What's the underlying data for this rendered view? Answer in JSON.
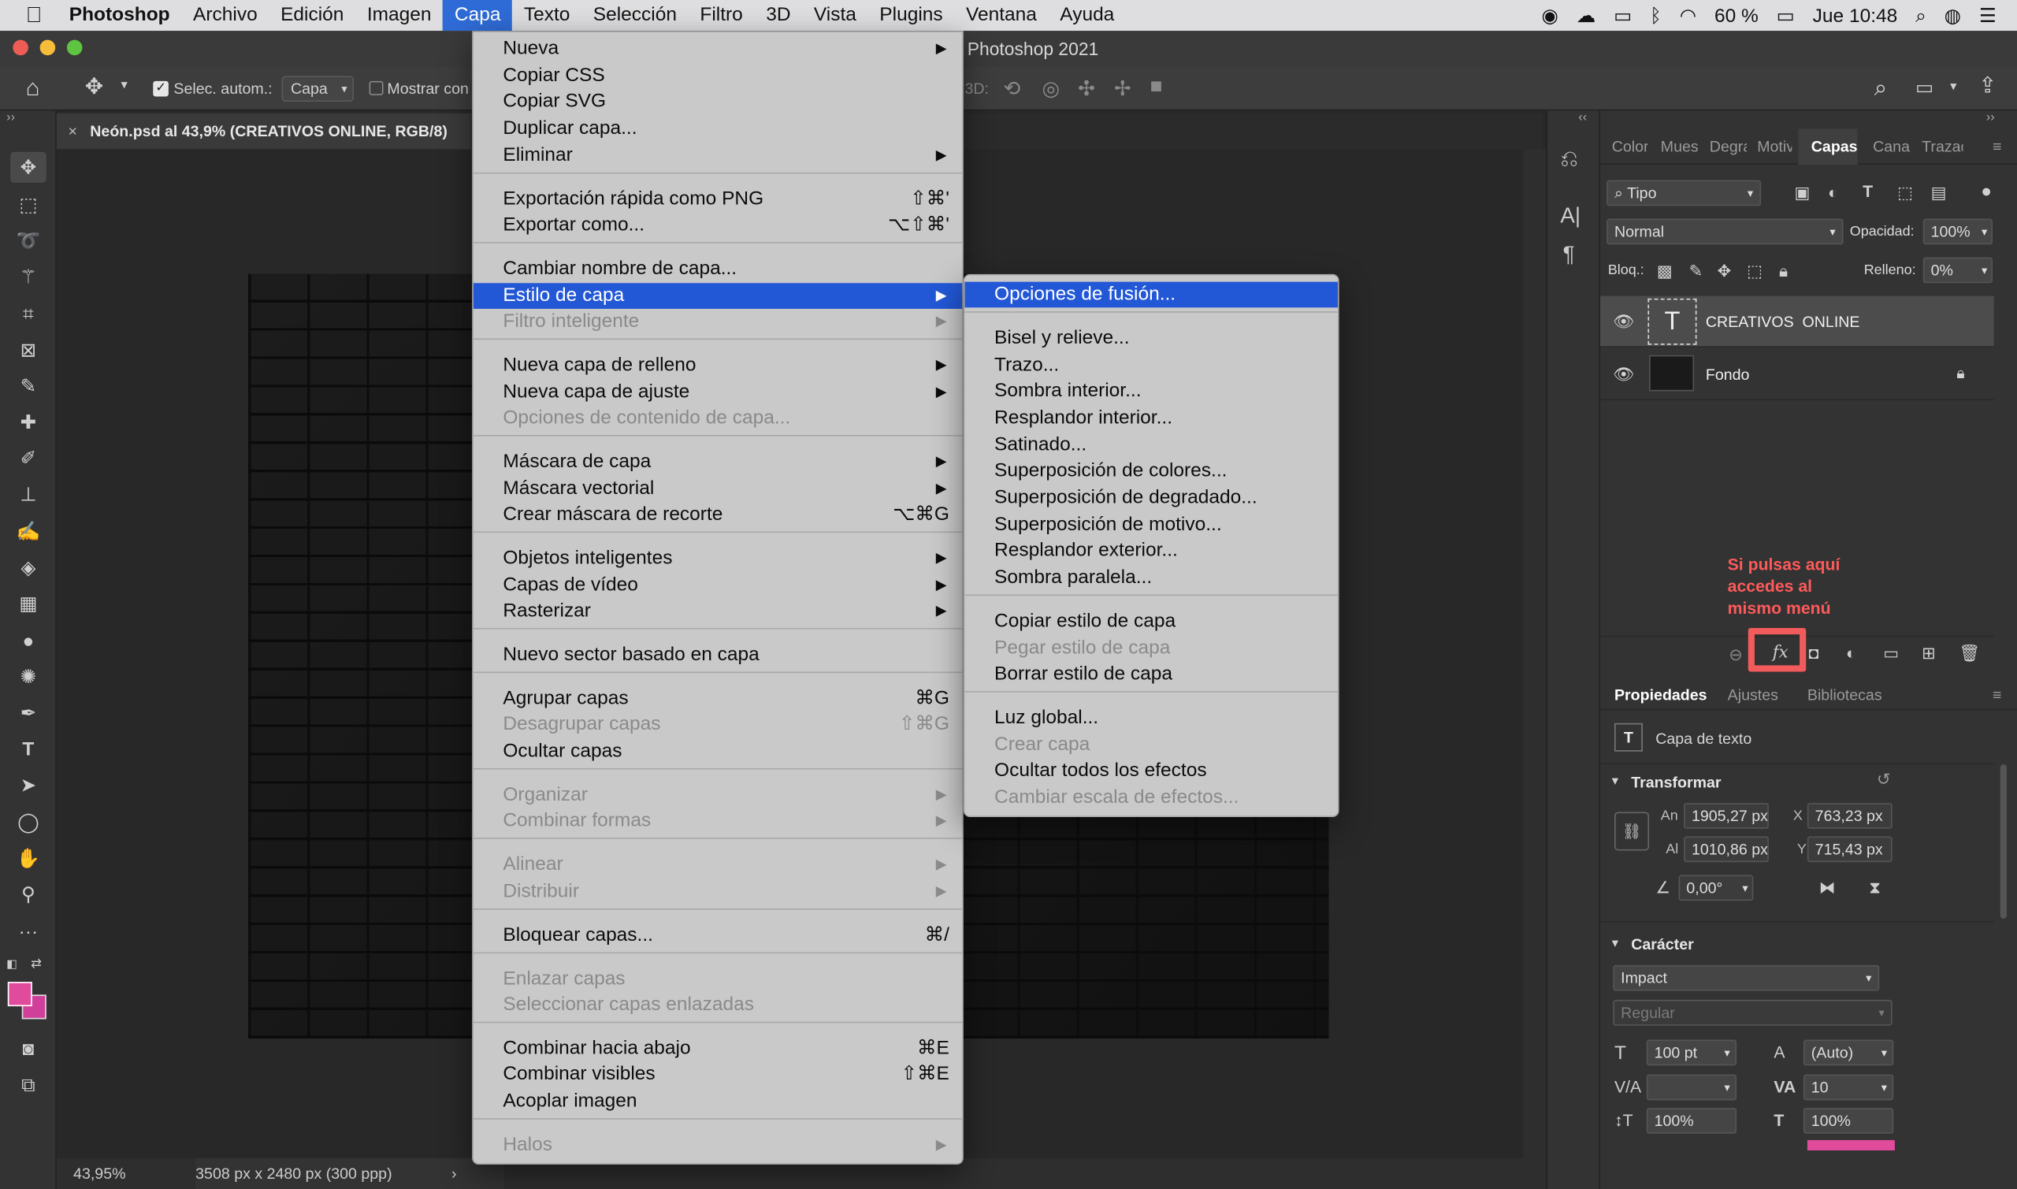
{
  "menubar": {
    "apple": "",
    "app": "Photoshop",
    "items": [
      "Archivo",
      "Edición",
      "Imagen",
      "Capa",
      "Texto",
      "Selección",
      "Filtro",
      "3D",
      "Vista",
      "Plugins",
      "Ventana",
      "Ayuda"
    ],
    "battery": "60 %",
    "clock": "Jue 10:48"
  },
  "window": {
    "title": "Photoshop 2021"
  },
  "options": {
    "autoselect_label": "Selec. autom.:",
    "autoselect_value": "Capa",
    "show_controls": "Mostrar con",
    "mode3d": "3D:"
  },
  "document": {
    "tab": "Neón.psd al 43,9% (CREATIVOS  ONLINE, RGB/8)",
    "zoom": "43,95%",
    "info": "3508 px x 2480 px (300 ppp)"
  },
  "capa_menu": {
    "items": [
      {
        "label": "Nueva",
        "submenu": true
      },
      {
        "label": "Copiar CSS"
      },
      {
        "label": "Copiar SVG"
      },
      {
        "label": "Duplicar capa..."
      },
      {
        "label": "Eliminar",
        "submenu": true
      },
      {
        "label": "Exportación rápida como PNG",
        "shortcut": "⇧⌘'"
      },
      {
        "label": "Exportar como...",
        "shortcut": "⌥⇧⌘'"
      },
      {
        "label": "Cambiar nombre de capa..."
      },
      {
        "label": "Estilo de capa",
        "submenu": true,
        "highlighted": true
      },
      {
        "label": "Filtro inteligente",
        "submenu": true,
        "disabled": true
      },
      {
        "label": "Nueva capa de relleno",
        "submenu": true
      },
      {
        "label": "Nueva capa de ajuste",
        "submenu": true
      },
      {
        "label": "Opciones de contenido de capa...",
        "disabled": true
      },
      {
        "label": "Máscara de capa",
        "submenu": true
      },
      {
        "label": "Máscara vectorial",
        "submenu": true
      },
      {
        "label": "Crear máscara de recorte",
        "shortcut": "⌥⌘G"
      },
      {
        "label": "Objetos inteligentes",
        "submenu": true
      },
      {
        "label": "Capas de vídeo",
        "submenu": true
      },
      {
        "label": "Rasterizar",
        "submenu": true
      },
      {
        "label": "Nuevo sector basado en capa"
      },
      {
        "label": "Agrupar capas",
        "shortcut": "⌘G"
      },
      {
        "label": "Desagrupar capas",
        "shortcut": "⇧⌘G",
        "disabled": true
      },
      {
        "label": "Ocultar capas"
      },
      {
        "label": "Organizar",
        "submenu": true,
        "disabled": true
      },
      {
        "label": "Combinar formas",
        "submenu": true,
        "disabled": true
      },
      {
        "label": "Alinear",
        "submenu": true,
        "disabled": true
      },
      {
        "label": "Distribuir",
        "submenu": true,
        "disabled": true
      },
      {
        "label": "Bloquear capas...",
        "shortcut": "⌘/"
      },
      {
        "label": "Enlazar capas",
        "disabled": true
      },
      {
        "label": "Seleccionar capas enlazadas",
        "disabled": true
      },
      {
        "label": "Combinar hacia abajo",
        "shortcut": "⌘E"
      },
      {
        "label": "Combinar visibles",
        "shortcut": "⇧⌘E"
      },
      {
        "label": "Acoplar imagen"
      },
      {
        "label": "Halos",
        "submenu": true,
        "disabled": true
      }
    ]
  },
  "estilo_submenu": {
    "items": [
      {
        "label": "Opciones de fusión...",
        "highlighted": true
      },
      {
        "label": "Bisel y relieve..."
      },
      {
        "label": "Trazo..."
      },
      {
        "label": "Sombra interior..."
      },
      {
        "label": "Resplandor interior..."
      },
      {
        "label": "Satinado..."
      },
      {
        "label": "Superposición de colores..."
      },
      {
        "label": "Superposición de degradado..."
      },
      {
        "label": "Superposición de motivo..."
      },
      {
        "label": "Resplandor exterior..."
      },
      {
        "label": "Sombra paralela..."
      },
      {
        "label": "Copiar estilo de capa"
      },
      {
        "label": "Pegar estilo de capa",
        "disabled": true
      },
      {
        "label": "Borrar estilo de capa"
      },
      {
        "label": "Luz global..."
      },
      {
        "label": "Crear capa",
        "disabled": true
      },
      {
        "label": "Ocultar todos los efectos"
      },
      {
        "label": "Cambiar escala de efectos...",
        "disabled": true
      }
    ]
  },
  "layers_panel": {
    "tabs": [
      "Color",
      "Muestras",
      "Degradados",
      "Motivos",
      "Capas",
      "Canales",
      "Trazados"
    ],
    "filter": "Tipo",
    "blend": "Normal",
    "opacity_label": "Opacidad:",
    "opacity": "100%",
    "lock_label": "Bloq.:",
    "fill_label": "Relleno:",
    "fill": "0%",
    "layers": [
      {
        "name": "CREATIVOS  ONLINE"
      },
      {
        "name": "Fondo"
      }
    ]
  },
  "annotation": "Si pulsas aquí accedes al mismo menú",
  "properties": {
    "tabs": [
      "Propiedades",
      "Ajustes",
      "Bibliotecas"
    ],
    "kind": "Capa de texto",
    "transform_title": "Transformar",
    "w_label": "An",
    "w": "1905,27 px",
    "h_label": "Al",
    "h": "1010,86 px",
    "x_label": "X",
    "x": "763,23 px",
    "y_label": "Y",
    "y": "715,43 px",
    "angle": "0,00°",
    "char_title": "Carácter",
    "font": "Impact",
    "style": "Regular",
    "size": "100 pt",
    "leading": "(Auto)",
    "tracking": "10",
    "vscale": "100%",
    "hscale": "100%"
  },
  "colors": {
    "foreground": "#e14b9b",
    "background": "#d0409a",
    "accent": "#2257d6",
    "annotation": "#f25b5b"
  }
}
